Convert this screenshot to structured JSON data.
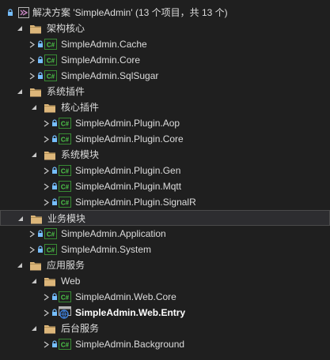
{
  "solution": {
    "label": "解决方案 'SimpleAdmin' (13 个项目，共 13 个)",
    "icon": "visual-studio-solution-icon"
  },
  "colors": {
    "background": "#1f1f1f",
    "text": "#dcdcdc",
    "folder": "#dcb67a",
    "csharp_project": "#388a34",
    "lock": "#75beff",
    "web_project": "#3e7ed8",
    "selected_row": "#2d2d30"
  },
  "tree": [
    {
      "type": "folder",
      "label": "架构核心",
      "expanded": true,
      "depth": 0,
      "children": [
        {
          "type": "project",
          "label": "SimpleAdmin.Cache",
          "depth": 1
        },
        {
          "type": "project",
          "label": "SimpleAdmin.Core",
          "depth": 1
        },
        {
          "type": "project",
          "label": "SimpleAdmin.SqlSugar",
          "depth": 1
        }
      ]
    },
    {
      "type": "folder",
      "label": "系统插件",
      "expanded": true,
      "depth": 0,
      "children": [
        {
          "type": "folder",
          "label": "核心插件",
          "expanded": true,
          "depth": 1,
          "children": [
            {
              "type": "project",
              "label": "SimpleAdmin.Plugin.Aop",
              "depth": 2
            },
            {
              "type": "project",
              "label": "SimpleAdmin.Plugin.Core",
              "depth": 2
            }
          ]
        },
        {
          "type": "folder",
          "label": "系统模块",
          "expanded": true,
          "depth": 1,
          "children": [
            {
              "type": "project",
              "label": "SimpleAdmin.Plugin.Gen",
              "depth": 2
            },
            {
              "type": "project",
              "label": "SimpleAdmin.Plugin.Mqtt",
              "depth": 2
            },
            {
              "type": "project",
              "label": "SimpleAdmin.Plugin.SignalR",
              "depth": 2
            }
          ]
        }
      ]
    },
    {
      "type": "folder",
      "label": "业务模块",
      "expanded": true,
      "selected": true,
      "depth": 0,
      "children": [
        {
          "type": "project",
          "label": "SimpleAdmin.Application",
          "depth": 1
        },
        {
          "type": "project",
          "label": "SimpleAdmin.System",
          "depth": 1
        }
      ]
    },
    {
      "type": "folder",
      "label": "应用服务",
      "expanded": true,
      "depth": 0,
      "children": [
        {
          "type": "folder",
          "label": "Web",
          "expanded": true,
          "depth": 1,
          "children": [
            {
              "type": "project",
              "label": "SimpleAdmin.Web.Core",
              "depth": 2
            },
            {
              "type": "web-project",
              "label": "SimpleAdmin.Web.Entry",
              "depth": 2,
              "bold": true
            }
          ]
        },
        {
          "type": "folder",
          "label": "后台服务",
          "expanded": true,
          "depth": 1,
          "children": [
            {
              "type": "project",
              "label": "SimpleAdmin.Background",
              "depth": 2
            }
          ]
        }
      ]
    }
  ]
}
